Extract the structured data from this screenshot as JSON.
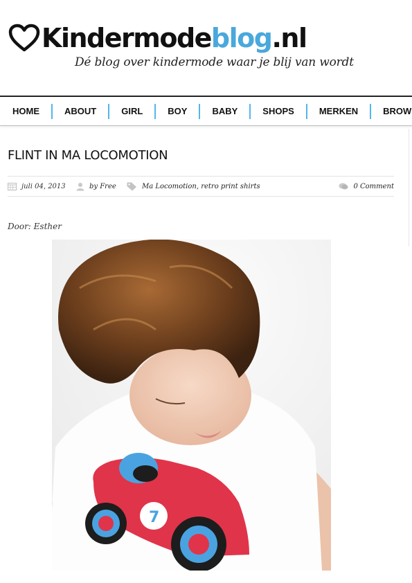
{
  "header": {
    "logo_main": "Kindermode",
    "logo_accent": "blog",
    "logo_end": ".nl",
    "tagline": "Dé blog over kindermode waar je blij van wordt"
  },
  "nav": {
    "items": [
      "HOME",
      "ABOUT",
      "GIRL",
      "BOY",
      "BABY",
      "SHOPS",
      "MERKEN",
      "BROW"
    ]
  },
  "post": {
    "title": "FLINT IN MA LOCOMOTION",
    "date": "juli 04, 2013",
    "author": "by Free",
    "tags": "Ma Locomotion, retro print shirts",
    "comments": "0 Comment",
    "byline": "Door: Esther"
  },
  "colors": {
    "accent": "#4aa8dc",
    "nav_separator": "#52b7e8",
    "car_red": "#e0344a",
    "car_blue": "#4aa3e0"
  },
  "icons": [
    "heart-icon",
    "calendar-icon",
    "user-icon",
    "tag-icon",
    "comment-icon"
  ]
}
